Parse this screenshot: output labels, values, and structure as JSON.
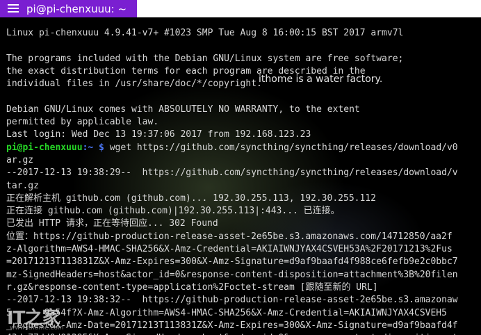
{
  "window": {
    "title": "pi@pi-chenxuuu: ~"
  },
  "terminal": {
    "lines": [
      {
        "text": "Linux pi-chenxuuu 4.9.41-v7+ #1023 SMP Tue Aug 8 16:00:15 BST 2017 armv7l"
      },
      {
        "text": ""
      },
      {
        "text": "The programs included with the Debian GNU/Linux system are free software;"
      },
      {
        "text": "the exact distribution terms for each program are described in the"
      },
      {
        "text": "individual files in /usr/share/doc/*/copyright."
      },
      {
        "text": ""
      },
      {
        "text": "Debian GNU/Linux comes with ABSOLUTELY NO WARRANTY, to the extent"
      },
      {
        "text": "permitted by applicable law."
      },
      {
        "text": "Last login: Wed Dec 13 19:37:06 2017 from 192.168.123.23"
      },
      {
        "prompt_user": "pi@pi-chenxuuu",
        "prompt_path": ":~ $",
        "text": " wget https://github.com/syncthing/syncthing/releases/download/v0"
      },
      {
        "text": "ar.gz"
      },
      {
        "text": "--2017-12-13 19:38:29--  https://github.com/syncthing/syncthing/releases/download/v"
      },
      {
        "text": "tar.gz"
      },
      {
        "text": "正在解析主机 github.com (github.com)... 192.30.255.113, 192.30.255.112"
      },
      {
        "text": "正在连接 github.com (github.com)|192.30.255.113|:443... 已连接。"
      },
      {
        "text": "已发出 HTTP 请求，正在等待回应... 302 Found"
      },
      {
        "text": "位置：https://github-production-release-asset-2e65be.s3.amazonaws.com/14712850/aa2f"
      },
      {
        "text": "z-Algorithm=AWS4-HMAC-SHA256&X-Amz-Credential=AKIAIWNJYAX4CSVEH53A%2F20171213%2Fus"
      },
      {
        "text": "=20171213T113831Z&X-Amz-Expires=300&X-Amz-Signature=d9af9baafd4f988ce6fefb9e2c0bbc7"
      },
      {
        "text": "mz-SignedHeaders=host&actor_id=0&response-content-disposition=attachment%3B%20filen"
      },
      {
        "text": "r.gz&response-content-type=application%2Foctet-stream [跟随至新的 URL]"
      },
      {
        "text": "--2017-12-13 19:38:32--  https://github-production-release-asset-2e65be.s3.amazonaw"
      },
      {
        "text": "5      9a54f?X-Amz-Algorithm=AWS4-HMAC-SHA256&X-Amz-Credential=AKIAIWNJYAX4CSVEH5"
      },
      {
        "text": "_request&X-Amz-Date=20171213T113831Z&X-Amz-Expires=300&X-Amz-Signature=d9af9baafd4f"
      },
      {
        "text": "43da77dd0d01295&X-Amz-SignedHeaders=host&actor_id=0&response-content-disposition=at"
      }
    ]
  },
  "watermark": {
    "text": "ithome is a water factory."
  },
  "logo": {
    "mark": "IT之家",
    "url": "www.ithome.com"
  }
}
